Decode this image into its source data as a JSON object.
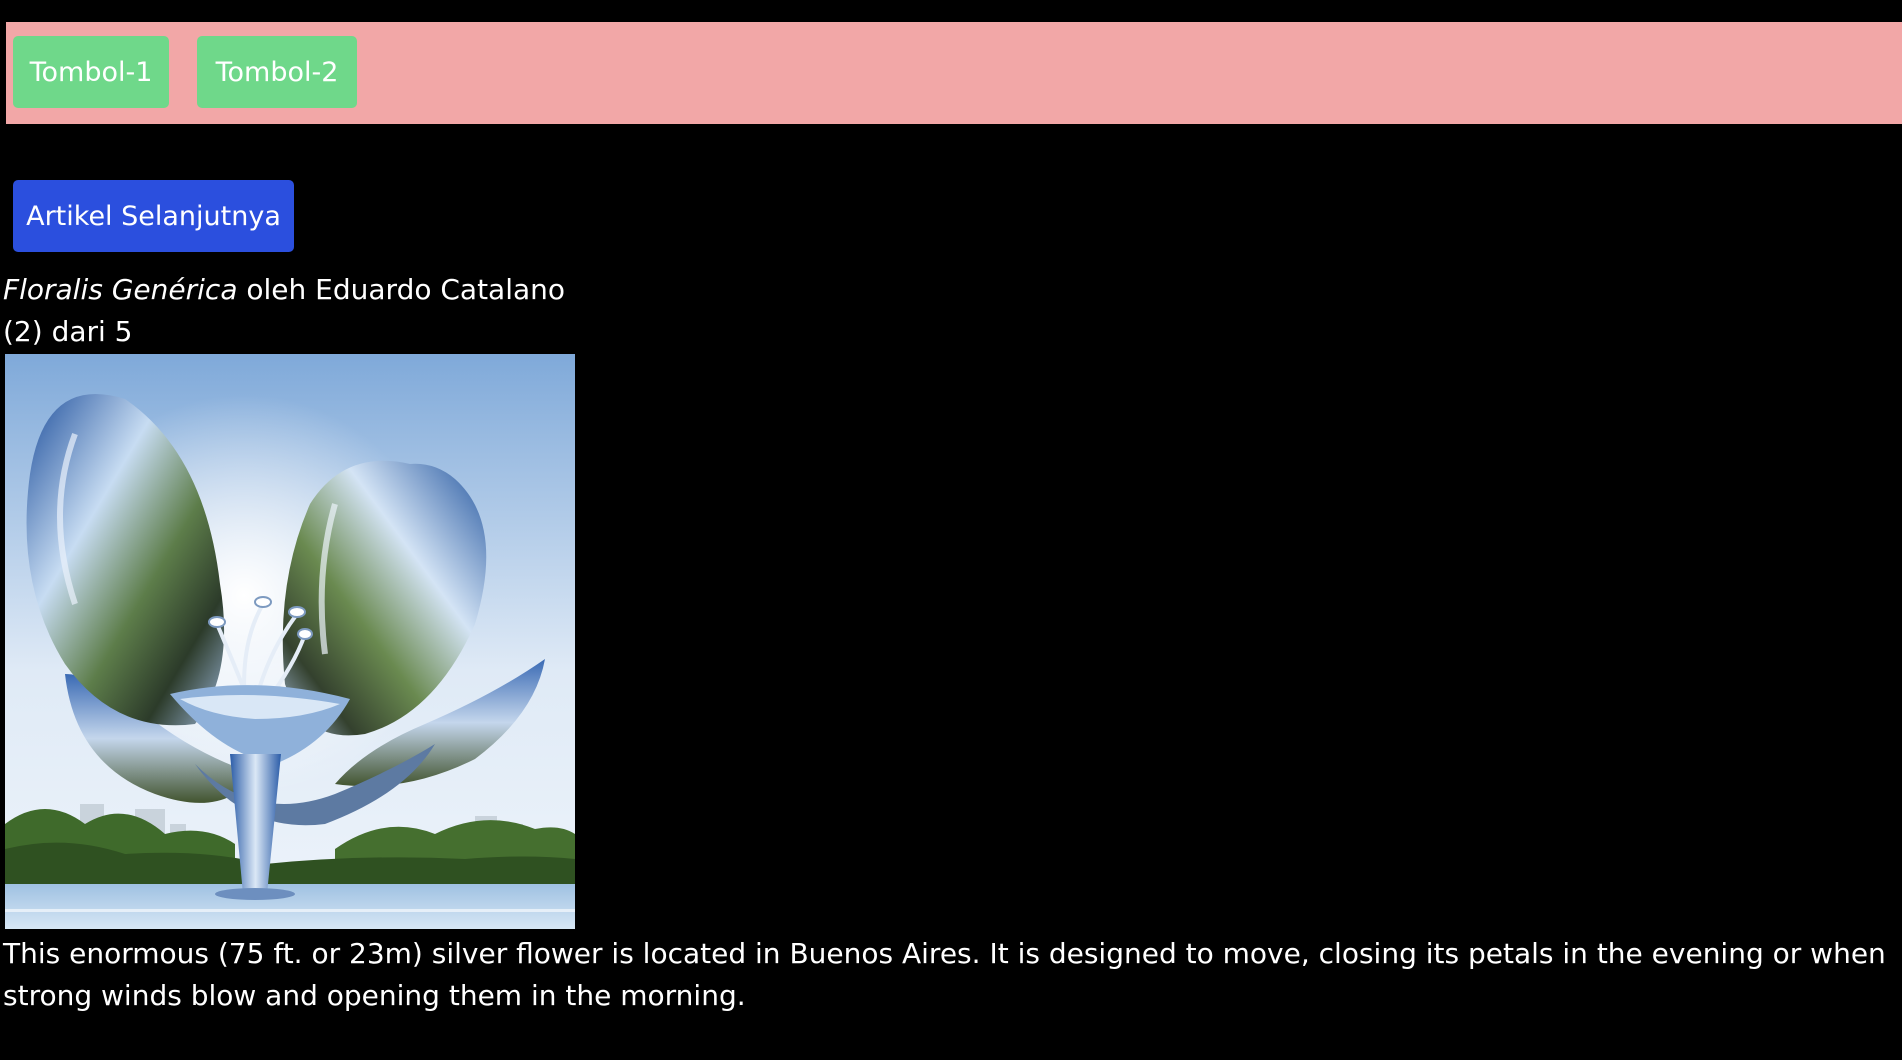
{
  "toolbar": {
    "button_1": "Tombol-1",
    "button_2": "Tombol-2",
    "colors": {
      "bar": "#f2a7a7",
      "button": "#6fd88a"
    }
  },
  "navigation": {
    "next_article": "Artikel Selanjutnya",
    "color": "#2b4fde"
  },
  "article": {
    "title_italic": "Floralis Genérica",
    "byline": "oleh Eduardo Catalano",
    "counter": "(2) dari 5",
    "description": "This enormous (75 ft. or 23m) silver flower is located in Buenos Aires. It is designed to move, closing its petals in the evening or when strong winds blow and opening them in the morning."
  }
}
